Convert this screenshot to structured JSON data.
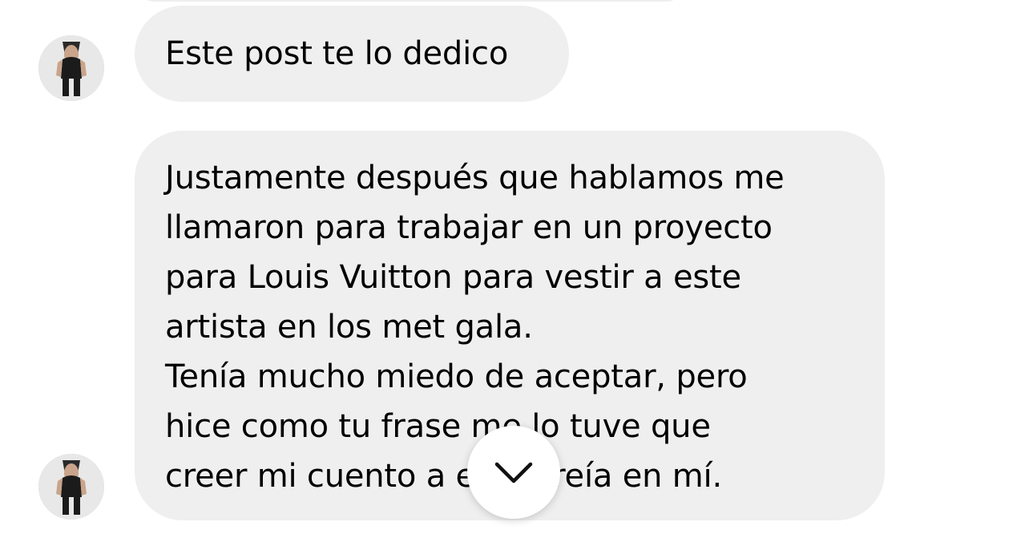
{
  "thread": {
    "messages": [
      {
        "sender_avatar": "person-photo-avatar",
        "paragraphs": [
          "Este post te lo dedico"
        ]
      },
      {
        "sender_avatar": "person-photo-avatar",
        "paragraphs": [
          "Justamente después que hablamos me\nllamaron para trabajar en un proyecto\npara Louis Vuitton para vestir a este\nartista en los met gala.",
          "Tenía mucho miedo de aceptar, pero\nhice como tu frase     me lo tuve que\ncreer mi cuento a          e no creía en mí."
        ]
      }
    ]
  },
  "scroll_button": {
    "icon": "chevron-down-icon"
  },
  "colors": {
    "bubble_background": "#efefef",
    "page_background": "#ffffff",
    "text": "#000000"
  }
}
